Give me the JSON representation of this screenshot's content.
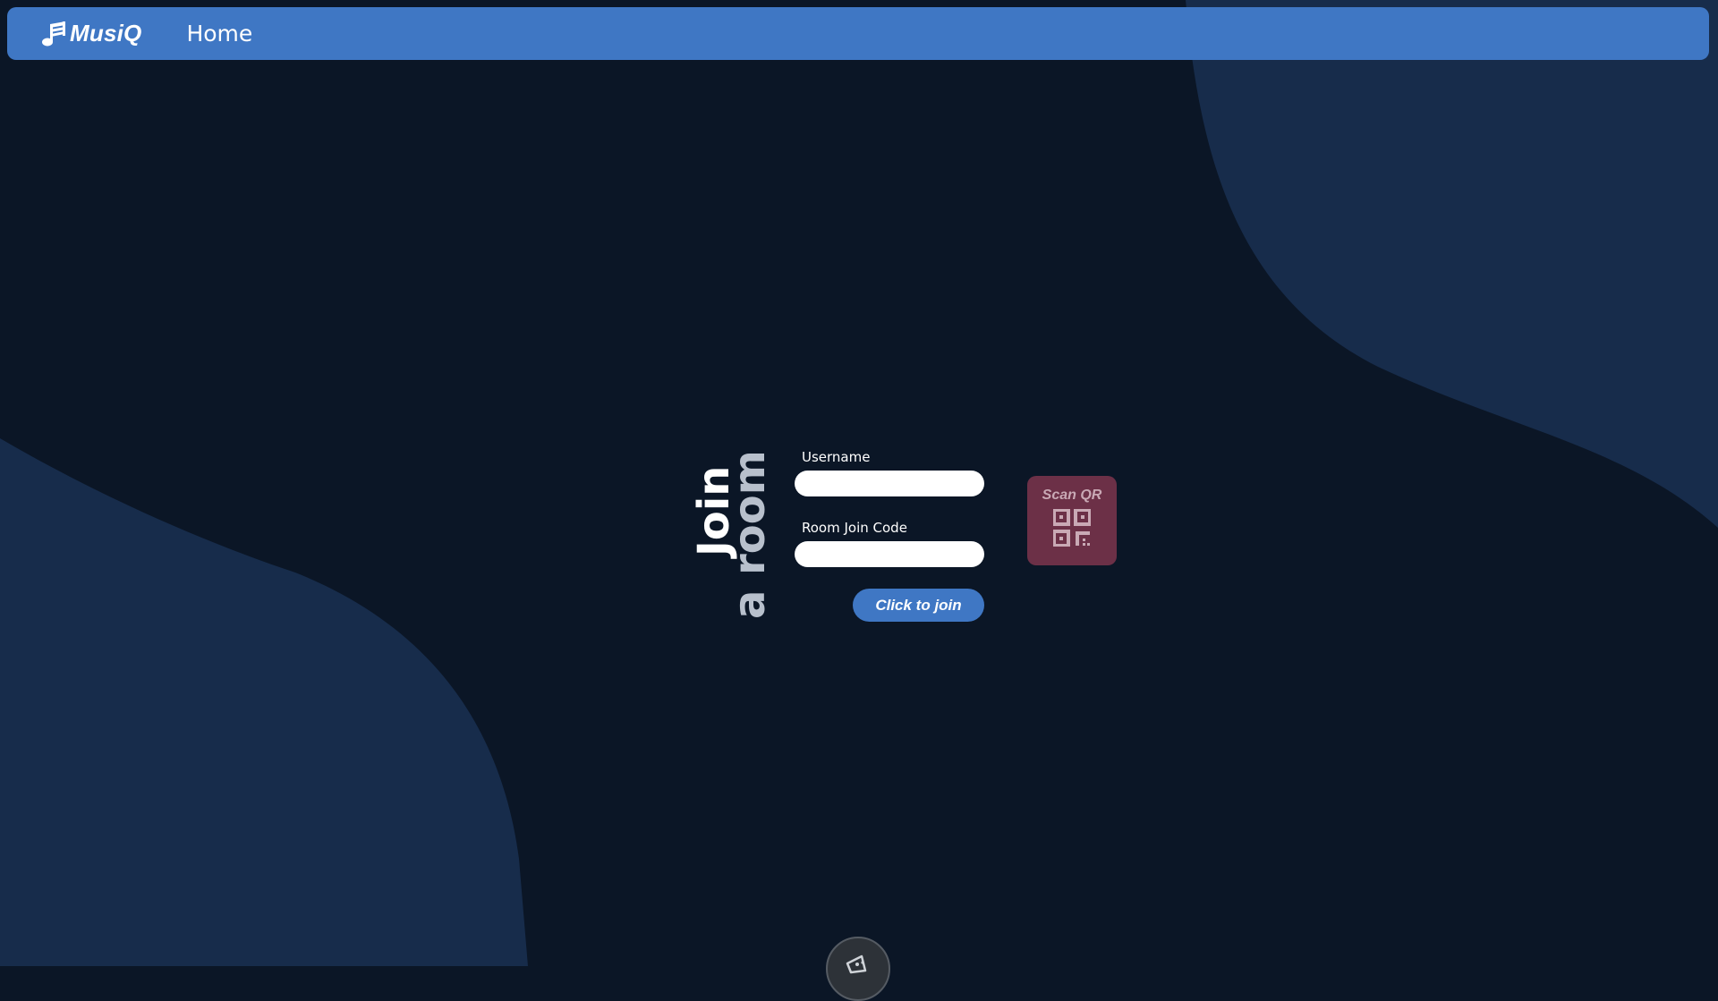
{
  "navbar": {
    "brand_label": "MusiQ",
    "brand_icon": "music-note-icon",
    "home_label": "Home"
  },
  "join_form": {
    "title_line1": "Join",
    "title_line2": "a room",
    "username_label": "Username",
    "username_value": "",
    "code_label": "Room Join Code",
    "code_value": "",
    "submit_label": "Click to join"
  },
  "scan_qr": {
    "label": "Scan QR",
    "icon": "qr-code-icon"
  },
  "floating_button": {
    "icon": "megaphone-icon"
  },
  "colors": {
    "background": "#0b1626",
    "background_shape": "#172c4b",
    "accent": "#3f77c4",
    "qr_card": "#6c3047",
    "title_secondary": "#b8c0cc"
  }
}
